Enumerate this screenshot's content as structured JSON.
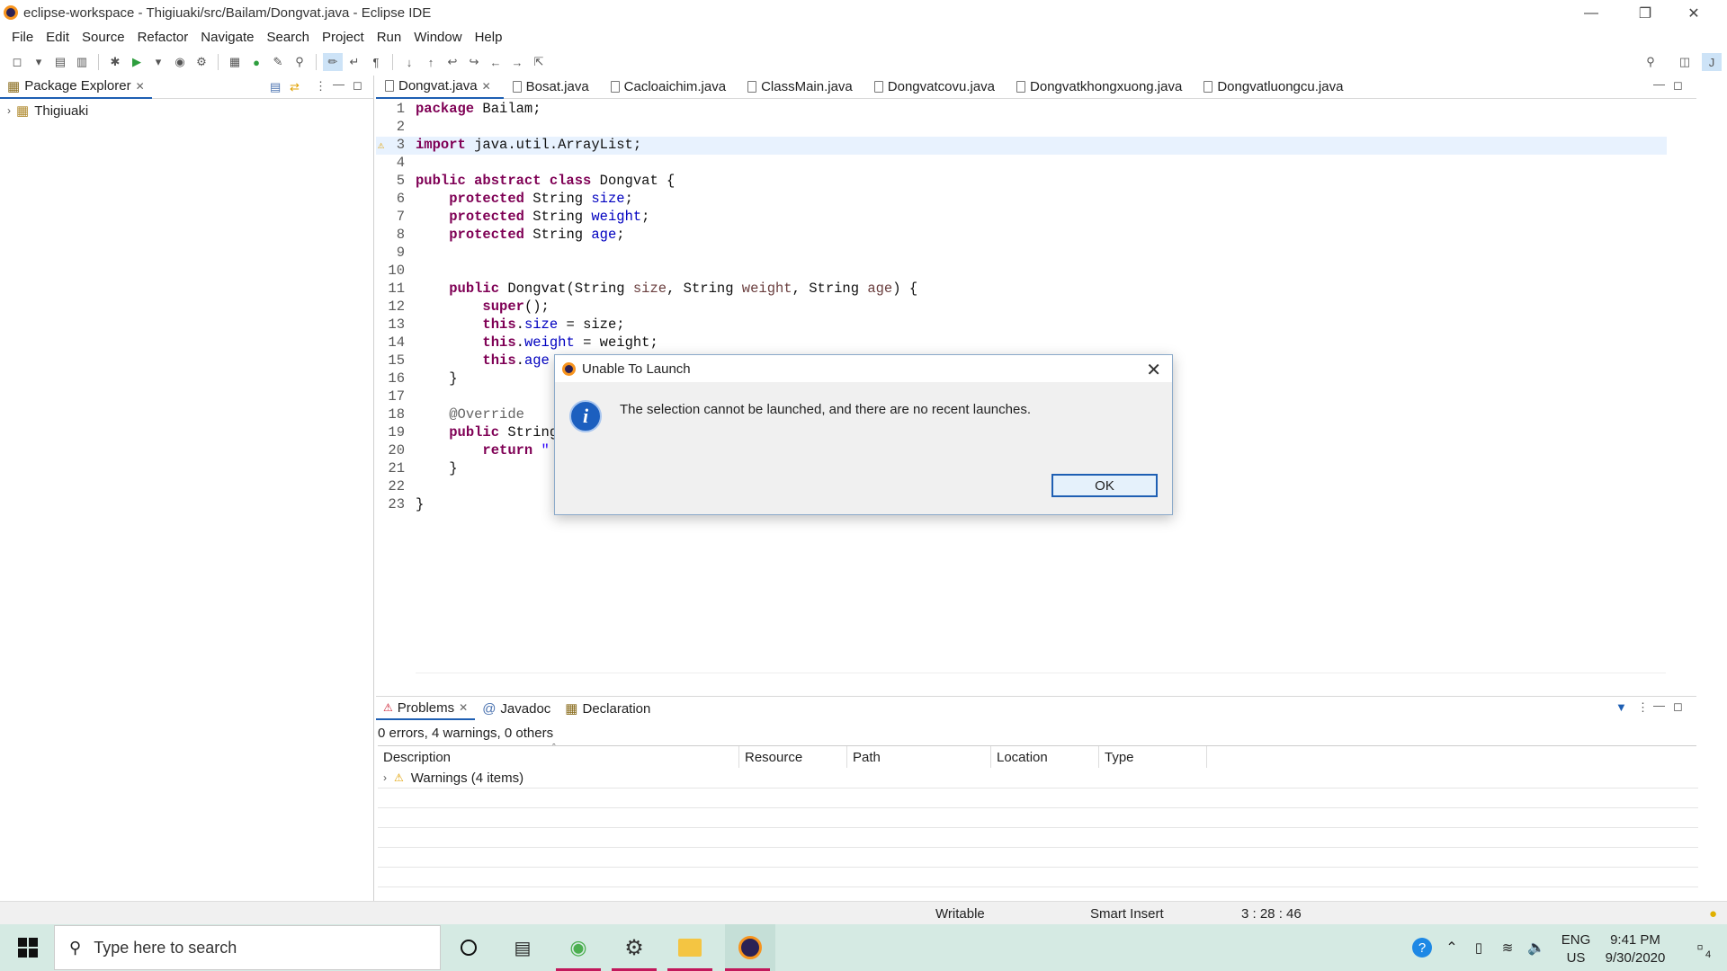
{
  "window": {
    "title": "eclipse-workspace - Thigiuaki/src/Bailam/Dongvat.java - Eclipse IDE"
  },
  "menu": [
    "File",
    "Edit",
    "Source",
    "Refactor",
    "Navigate",
    "Search",
    "Project",
    "Run",
    "Window",
    "Help"
  ],
  "package_explorer": {
    "tab_label": "Package Explorer",
    "project": "Thigiuaki"
  },
  "editor": {
    "tabs": [
      "Dongvat.java",
      "Bosat.java",
      "Cacloaichim.java",
      "ClassMain.java",
      "Dongvatcovu.java",
      "Dongvatkhongxuong.java",
      "Dongvatluongcu.java"
    ],
    "active_tab": "Dongvat.java",
    "lines": [
      {
        "n": "1",
        "text": "package Bailam;"
      },
      {
        "n": "2",
        "text": ""
      },
      {
        "n": "3",
        "text": "import java.util.ArrayList;"
      },
      {
        "n": "4",
        "text": ""
      },
      {
        "n": "5",
        "text": "public abstract class Dongvat {"
      },
      {
        "n": "6",
        "text": "    protected String size;"
      },
      {
        "n": "7",
        "text": "    protected String weight;"
      },
      {
        "n": "8",
        "text": "    protected String age;"
      },
      {
        "n": "9",
        "text": ""
      },
      {
        "n": "10",
        "text": ""
      },
      {
        "n": "11",
        "text": "    public Dongvat(String size, String weight, String age) {"
      },
      {
        "n": "12",
        "text": "        super();"
      },
      {
        "n": "13",
        "text": "        this.size = size;"
      },
      {
        "n": "14",
        "text": "        this.weight = weight;"
      },
      {
        "n": "15",
        "text": "        this.age ="
      },
      {
        "n": "16",
        "text": "    }"
      },
      {
        "n": "17",
        "text": ""
      },
      {
        "n": "18",
        "text": "    @Override"
      },
      {
        "n": "19",
        "text": "    public String"
      },
      {
        "n": "20",
        "text": "        return \""
      },
      {
        "n": "21",
        "text": "    }"
      },
      {
        "n": "22",
        "text": ""
      },
      {
        "n": "23",
        "text": "}"
      }
    ]
  },
  "bottom_panel": {
    "tabs": [
      "Problems",
      "Javadoc",
      "Declaration"
    ],
    "summary": "0 errors, 4 warnings, 0 others",
    "columns": [
      "Description",
      "Resource",
      "Path",
      "Location",
      "Type"
    ],
    "rows": [
      {
        "description": "Warnings (4 items)"
      }
    ]
  },
  "status_bar": {
    "writable": "Writable",
    "insert_mode": "Smart Insert",
    "position": "3 : 28 : 46"
  },
  "taskbar": {
    "search_placeholder": "Type here to search",
    "lang": "ENG",
    "region": "US",
    "time": "9:41 PM",
    "date": "9/30/2020",
    "notifications": "4"
  },
  "dialog": {
    "title": "Unable To Launch",
    "message": "The selection cannot be launched, and there are no recent launches.",
    "ok_label": "OK"
  },
  "colors": {
    "accent": "#1e5fb3",
    "taskbar": "#d5eae3",
    "keyword": "#7f0055",
    "field": "#0000c0"
  }
}
